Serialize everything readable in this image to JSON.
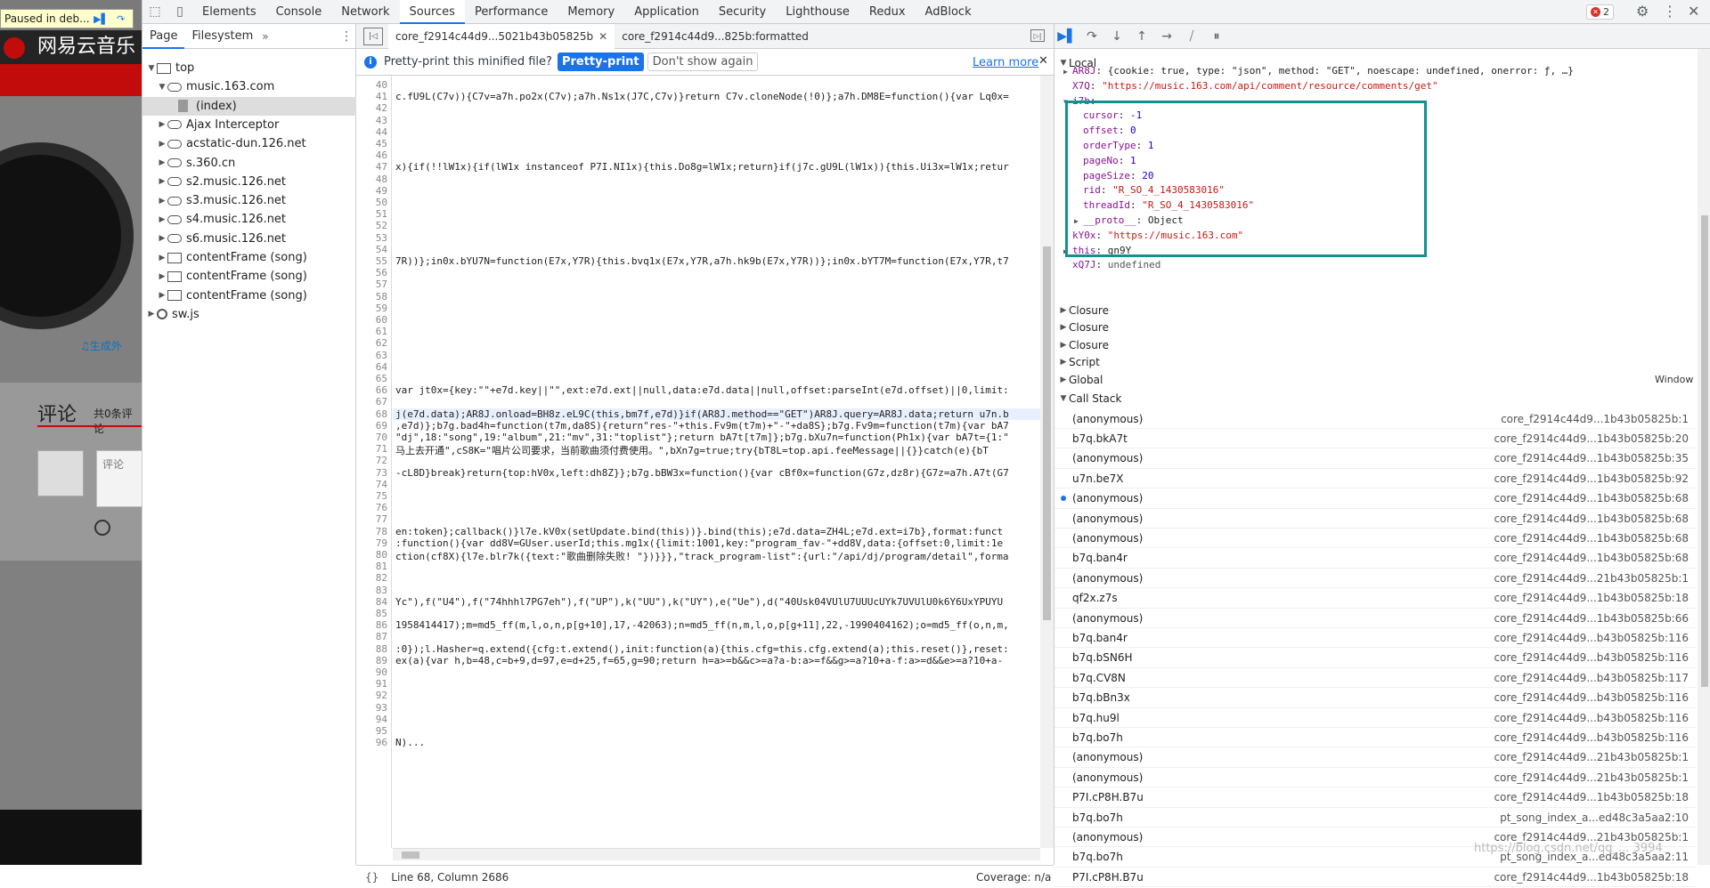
{
  "page": {
    "paused_label": "Paused in deb...",
    "site_title": "网易云音乐",
    "generate_link": "♫生成外",
    "comments_heading": "评论",
    "comments_count": "共0条评论",
    "comment_placeholder": "评论"
  },
  "devtools": {
    "tabs": [
      "Elements",
      "Console",
      "Network",
      "Sources",
      "Performance",
      "Memory",
      "Application",
      "Security",
      "Lighthouse",
      "Redux",
      "AdBlock"
    ],
    "active_tab": "Sources",
    "error_count": "2"
  },
  "navigator": {
    "tabs": [
      "Page",
      "Filesystem"
    ],
    "more": "»",
    "tree": [
      {
        "label": "top",
        "icon": "frame",
        "arrow": "▼",
        "indent": 0
      },
      {
        "label": "music.163.com",
        "icon": "cloud",
        "arrow": "▼",
        "indent": 1
      },
      {
        "label": "(index)",
        "icon": "file",
        "arrow": "",
        "indent": 2,
        "selected": true
      },
      {
        "label": "Ajax Interceptor",
        "icon": "cloud",
        "arrow": "▶",
        "indent": 1
      },
      {
        "label": "acstatic-dun.126.net",
        "icon": "cloud",
        "arrow": "▶",
        "indent": 1
      },
      {
        "label": "s.360.cn",
        "icon": "cloud",
        "arrow": "▶",
        "indent": 1
      },
      {
        "label": "s2.music.126.net",
        "icon": "cloud",
        "arrow": "▶",
        "indent": 1
      },
      {
        "label": "s3.music.126.net",
        "icon": "cloud",
        "arrow": "▶",
        "indent": 1
      },
      {
        "label": "s4.music.126.net",
        "icon": "cloud",
        "arrow": "▶",
        "indent": 1
      },
      {
        "label": "s6.music.126.net",
        "icon": "cloud",
        "arrow": "▶",
        "indent": 1
      },
      {
        "label": "contentFrame (song)",
        "icon": "frame",
        "arrow": "▶",
        "indent": 1
      },
      {
        "label": "contentFrame (song)",
        "icon": "frame",
        "arrow": "▶",
        "indent": 1
      },
      {
        "label": "contentFrame (song)",
        "icon": "frame",
        "arrow": "▶",
        "indent": 1
      },
      {
        "label": "sw.js",
        "icon": "gear",
        "arrow": "▶",
        "indent": 0
      }
    ]
  },
  "editor": {
    "tabs": [
      {
        "label": "core_f2914c44d9...5021b43b05825b",
        "active": true,
        "closable": true
      },
      {
        "label": "core_f2914c44d9...825b:formatted",
        "active": false,
        "closable": false
      }
    ],
    "info_text": "Pretty-print this minified file?",
    "pretty_print_button": "Pretty-print",
    "dont_show_button": "Don't show again",
    "learn_more": "Learn more",
    "status_position": "Line 68, Column 2686",
    "coverage": "Coverage: n/a",
    "lines": [
      {
        "n": "40",
        "code": ""
      },
      {
        "n": "41",
        "code": "c.fU9L(C7v)){C7v=a7h.po2x(C7v);a7h.Ns1x(J7C,C7v)}return C7v.cloneNode(!0)};a7h.DM8E=function(){var Lq0x="
      },
      {
        "n": "42",
        "code": ""
      },
      {
        "n": "43",
        "code": ""
      },
      {
        "n": "44",
        "code": ""
      },
      {
        "n": "45",
        "code": ""
      },
      {
        "n": "46",
        "code": ""
      },
      {
        "n": "47",
        "code": "x){if(!!lW1x){if(lW1x instanceof P7I.NI1x){this.Do8g=lW1x;return}if(j7c.gU9L(lW1x)){this.Ui3x=lW1x;retur"
      },
      {
        "n": "48",
        "code": ""
      },
      {
        "n": "49",
        "code": ""
      },
      {
        "n": "50",
        "code": ""
      },
      {
        "n": "51",
        "code": ""
      },
      {
        "n": "52",
        "code": ""
      },
      {
        "n": "53",
        "code": ""
      },
      {
        "n": "54",
        "code": ""
      },
      {
        "n": "55",
        "code": "7R))};in0x.bYU7N=function(E7x,Y7R){this.bvq1x(E7x,Y7R,a7h.hk9b(E7x,Y7R))};in0x.bYT7M=function(E7x,Y7R,t7"
      },
      {
        "n": "56",
        "code": ""
      },
      {
        "n": "57",
        "code": ""
      },
      {
        "n": "58",
        "code": ""
      },
      {
        "n": "59",
        "code": ""
      },
      {
        "n": "60",
        "code": ""
      },
      {
        "n": "61",
        "code": ""
      },
      {
        "n": "62",
        "code": ""
      },
      {
        "n": "63",
        "code": ""
      },
      {
        "n": "64",
        "code": ""
      },
      {
        "n": "65",
        "code": ""
      },
      {
        "n": "66",
        "code": "var jt0x={key:\"\"+e7d.key||\"\",ext:e7d.ext||null,data:e7d.data||null,offset:parseInt(e7d.offset)||0,limit:"
      },
      {
        "n": "67",
        "code": ""
      },
      {
        "n": "68",
        "code": "j(e7d.data);AR8J.onload=BH8z.eL9C(this,bm7f,e7d)}if(AR8J.method==\"GET\")AR8J.query=AR8J.data;return u7n.b",
        "hl": true
      },
      {
        "n": "69",
        "code": ",e7d)};b7g.bad4h=function(t7m,da8S){return\"res-\"+this.Fv9m(t7m)+\"-\"+da8S};b7g.Fv9m=function(t7m){var bA7"
      },
      {
        "n": "70",
        "code": "\"dj\",18:\"song\",19:\"album\",21:\"mv\",31:\"toplist\"};return bA7t[t7m]};b7g.bXu7n=function(Ph1x){var bA7t={1:\""
      },
      {
        "n": "71",
        "code": "马上去开通\",cS8K=\"唱片公司要求，当前歌曲须付费使用。\",bXn7g=true;try{bT8L=top.api.feeMessage||{}}catch(e){bT"
      },
      {
        "n": "72",
        "code": ""
      },
      {
        "n": "73",
        "code": "-cL8D}break}return{top:hV0x,left:dh8Z}};b7g.bBW3x=function(){var cBf0x=function(G7z,dz8r){G7z=a7h.A7t(G7"
      },
      {
        "n": "74",
        "code": ""
      },
      {
        "n": "75",
        "code": ""
      },
      {
        "n": "76",
        "code": ""
      },
      {
        "n": "77",
        "code": ""
      },
      {
        "n": "78",
        "code": "en:token};callback()}l7e.kV0x(setUpdate.bind(this))}.bind(this);e7d.data=ZH4L;e7d.ext=i7b},format:funct"
      },
      {
        "n": "79",
        "code": ":function(){var dd8V=GUser.userId;this.mg1x({limit:1001,key:\"program_fav-\"+dd8V,data:{offset:0,limit:1e"
      },
      {
        "n": "80",
        "code": "ction(cf8X){l7e.blr7k({text:\"歌曲删除失败! \"})}}},\"track_program-list\":{url:\"/api/dj/program/detail\",forma"
      },
      {
        "n": "81",
        "code": ""
      },
      {
        "n": "82",
        "code": ""
      },
      {
        "n": "83",
        "code": ""
      },
      {
        "n": "84",
        "code": "Yc\"),f(\"U4\"),f(\"74hhhl7PG7eh\"),f(\"UP\"),k(\"UU\"),k(\"UY\"),e(\"Ue\"),d(\"40Usk04VUlU7UUUcUYk7UVUlU0k6Y6UxYPUYU"
      },
      {
        "n": "85",
        "code": ""
      },
      {
        "n": "86",
        "code": "1958414417);m=md5_ff(m,l,o,n,p[g+10],17,-42063);n=md5_ff(n,m,l,o,p[g+11],22,-1990404162);o=md5_ff(o,n,m,"
      },
      {
        "n": "87",
        "code": ""
      },
      {
        "n": "88",
        "code": ":0});l.Hasher=q.extend({cfg:t.extend(),init:function(a){this.cfg=this.cfg.extend(a);this.reset()},reset:"
      },
      {
        "n": "89",
        "code": "ex(a){var h,b=48,c=b+9,d=97,e=d+25,f=65,g=90;return h=a>=b&&c>=a?a-b:a>=f&&g>=a?10+a-f:a>=d&&e>=a?10+a-"
      },
      {
        "n": "90",
        "code": ""
      },
      {
        "n": "91",
        "code": ""
      },
      {
        "n": "92",
        "code": ""
      },
      {
        "n": "93",
        "code": ""
      },
      {
        "n": "94",
        "code": ""
      },
      {
        "n": "95",
        "code": ""
      },
      {
        "n": "96",
        "code": "N)..."
      }
    ]
  },
  "debugger": {
    "toolbar": [
      "resume-icon",
      "step-over-icon",
      "step-into-icon",
      "step-out-icon",
      "step-icon",
      "deactivate-breakpoints-icon",
      "pause-on-exceptions-icon"
    ],
    "scope": {
      "local_label": "Local",
      "vars": [
        {
          "indent": 1,
          "arrow": "▶",
          "name": "AR8J",
          "sep": ": ",
          "value": "{cookie: true, type: \"json\", method: \"GET\", noescape: undefined, onerror: ƒ, …}",
          "kind": "obj"
        },
        {
          "indent": 1,
          "arrow": "",
          "name": "X7Q",
          "sep": ": ",
          "value": "\"https://music.163.com/api/comment/resource/comments/get\"",
          "kind": "str"
        },
        {
          "indent": 1,
          "arrow": "▼",
          "name": "i7b",
          "sep": ":",
          "value": "",
          "kind": "obj"
        },
        {
          "indent": 2,
          "arrow": "",
          "name": "cursor",
          "sep": ": ",
          "value": "-1",
          "kind": "num"
        },
        {
          "indent": 2,
          "arrow": "",
          "name": "offset",
          "sep": ": ",
          "value": "0",
          "kind": "num"
        },
        {
          "indent": 2,
          "arrow": "",
          "name": "orderType",
          "sep": ": ",
          "value": "1",
          "kind": "num"
        },
        {
          "indent": 2,
          "arrow": "",
          "name": "pageNo",
          "sep": ": ",
          "value": "1",
          "kind": "num"
        },
        {
          "indent": 2,
          "arrow": "",
          "name": "pageSize",
          "sep": ": ",
          "value": "20",
          "kind": "num"
        },
        {
          "indent": 2,
          "arrow": "",
          "name": "rid",
          "sep": ": ",
          "value": "\"R_SO_4_1430583016\"",
          "kind": "str"
        },
        {
          "indent": 2,
          "arrow": "",
          "name": "threadId",
          "sep": ": ",
          "value": "\"R_SO_4_1430583016\"",
          "kind": "str"
        },
        {
          "indent": 2,
          "arrow": "▶",
          "name": "__proto__",
          "sep": ": ",
          "value": "Object",
          "kind": "obj"
        },
        {
          "indent": 1,
          "arrow": "",
          "name": "kY0x",
          "sep": ": ",
          "value": "\"https://music.163.com\"",
          "kind": "str"
        },
        {
          "indent": 1,
          "arrow": "▶",
          "name": "this",
          "sep": ": ",
          "value": "gn9Y",
          "kind": "obj"
        },
        {
          "indent": 1,
          "arrow": "",
          "name": "xQ7J",
          "sep": ": ",
          "value": "undefined",
          "kind": "undef"
        }
      ],
      "sections": [
        "Closure",
        "Closure",
        "Closure",
        "Script",
        "Global"
      ],
      "global_value": "Window"
    },
    "call_stack_label": "Call Stack",
    "call_stack": [
      {
        "fn": "(anonymous)",
        "loc": "core_f2914c44d9...1b43b05825b:1"
      },
      {
        "fn": "b7q.bkA7t",
        "loc": "core_f2914c44d9...1b43b05825b:20"
      },
      {
        "fn": "(anonymous)",
        "loc": "core_f2914c44d9...1b43b05825b:35"
      },
      {
        "fn": "u7n.be7X",
        "loc": "core_f2914c44d9...1b43b05825b:92"
      },
      {
        "fn": "(anonymous)",
        "loc": "core_f2914c44d9...1b43b05825b:68",
        "current": true
      },
      {
        "fn": "(anonymous)",
        "loc": "core_f2914c44d9...1b43b05825b:68"
      },
      {
        "fn": "(anonymous)",
        "loc": "core_f2914c44d9...1b43b05825b:68"
      },
      {
        "fn": "b7q.ban4r",
        "loc": "core_f2914c44d9...1b43b05825b:68"
      },
      {
        "fn": "(anonymous)",
        "loc": "core_f2914c44d9...21b43b05825b:1"
      },
      {
        "fn": "qf2x.z7s",
        "loc": "core_f2914c44d9...1b43b05825b:18"
      },
      {
        "fn": "(anonymous)",
        "loc": "core_f2914c44d9...1b43b05825b:66"
      },
      {
        "fn": "b7q.ban4r",
        "loc": "core_f2914c44d9...b43b05825b:116"
      },
      {
        "fn": "b7q.bSN6H",
        "loc": "core_f2914c44d9...b43b05825b:116"
      },
      {
        "fn": "b7q.CV8N",
        "loc": "core_f2914c44d9...b43b05825b:117"
      },
      {
        "fn": "b7q.bBn3x",
        "loc": "core_f2914c44d9...b43b05825b:116"
      },
      {
        "fn": "b7q.hu9l",
        "loc": "core_f2914c44d9...b43b05825b:116"
      },
      {
        "fn": "b7q.bo7h",
        "loc": "core_f2914c44d9...b43b05825b:116"
      },
      {
        "fn": "(anonymous)",
        "loc": "core_f2914c44d9...21b43b05825b:1"
      },
      {
        "fn": "(anonymous)",
        "loc": "core_f2914c44d9...21b43b05825b:1"
      },
      {
        "fn": "P7I.cP8H.B7u",
        "loc": "core_f2914c44d9...1b43b05825b:18"
      },
      {
        "fn": "b7q.bo7h",
        "loc": "pt_song_index_a...ed48c3a5aa2:10"
      },
      {
        "fn": "(anonymous)",
        "loc": "core_f2914c44d9...21b43b05825b:1"
      },
      {
        "fn": "b7q.bo7h",
        "loc": "pt_song_index_a...ed48c3a5aa2:11"
      },
      {
        "fn": "P7I.cP8H.B7u",
        "loc": "core_f2914c44d9...1b43b05825b:18"
      }
    ],
    "watermark": "https://blog.csdn.net/qq_... 3994"
  }
}
